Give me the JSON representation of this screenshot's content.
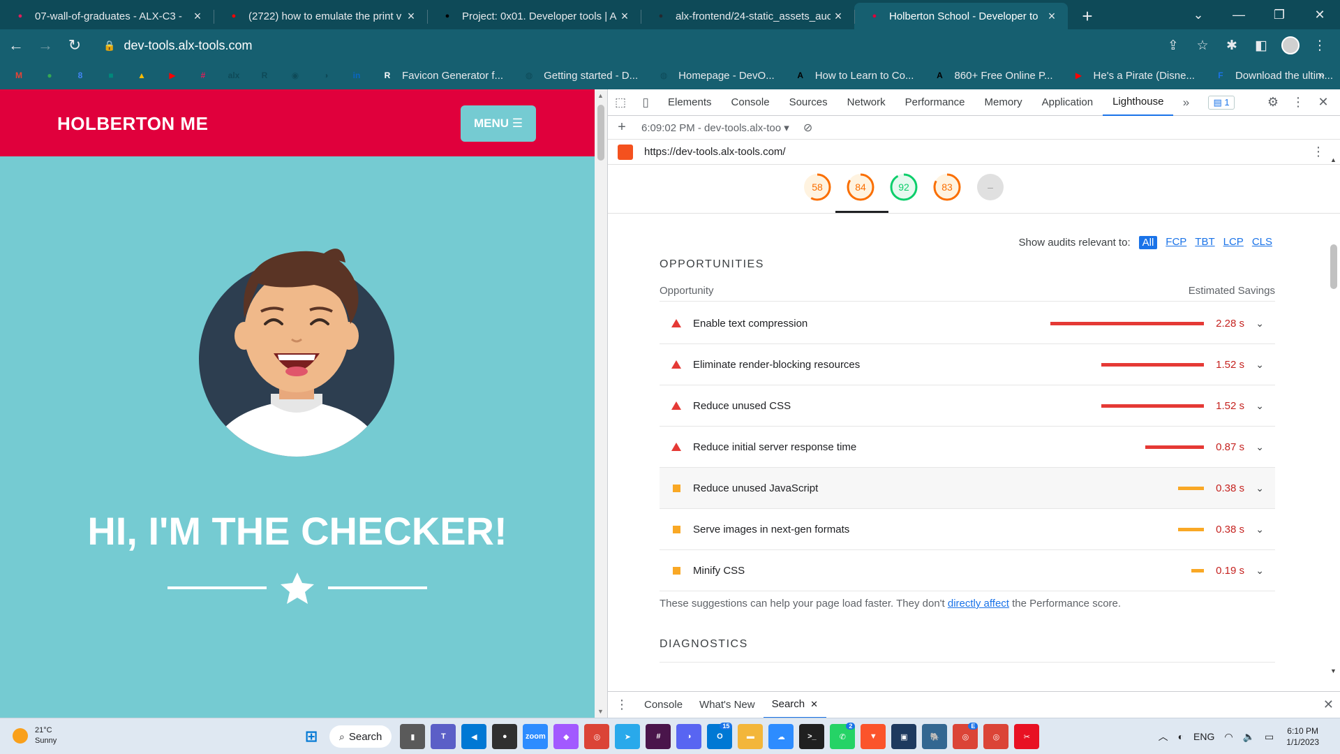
{
  "browser": {
    "tabs": [
      {
        "title": "07-wall-of-graduates - ALX-C3 -",
        "favicon": "slack-icon",
        "color": "#e01e5a",
        "active": false
      },
      {
        "title": "(2722) how to emulate the print v",
        "favicon": "youtube-icon",
        "color": "#ff0000",
        "active": false
      },
      {
        "title": "Project: 0x01. Developer tools | A",
        "favicon": "alx-icon",
        "color": "#000000",
        "active": false
      },
      {
        "title": "alx-frontend/24-static_assets_auc",
        "favicon": "github-icon",
        "color": "#24292f",
        "active": false
      },
      {
        "title": "Holberton School - Developer to",
        "favicon": "holberton-icon",
        "color": "#e0003c",
        "active": true
      }
    ],
    "url": "dev-tools.alx-tools.com",
    "bookmarks": [
      {
        "label": "",
        "icon": "gmail-icon",
        "color": "#ea4335",
        "glyph": "M"
      },
      {
        "label": "",
        "icon": "maps-icon",
        "color": "#34a853",
        "glyph": "●"
      },
      {
        "label": "",
        "icon": "calendar-icon",
        "color": "#4285f4",
        "glyph": "8"
      },
      {
        "label": "",
        "icon": "meet-icon",
        "color": "#00897b",
        "glyph": "■"
      },
      {
        "label": "",
        "icon": "drive-icon",
        "color": "#fbbc04",
        "glyph": "▲"
      },
      {
        "label": "",
        "icon": "youtube-icon",
        "color": "#ff0000",
        "glyph": "▶"
      },
      {
        "label": "",
        "icon": "slack-icon",
        "color": "#e01e5a",
        "glyph": "#"
      },
      {
        "label": "",
        "icon": "alx-icon",
        "color": "#0e4a58",
        "glyph": "alx"
      },
      {
        "label": "",
        "icon": "r-icon",
        "color": "#0e4a58",
        "glyph": "R"
      },
      {
        "label": "",
        "icon": "github-icon",
        "color": "#0e4a58",
        "glyph": "◉"
      },
      {
        "label": "",
        "icon": "discord-icon",
        "color": "#0e4a58",
        "glyph": "◑"
      },
      {
        "label": "",
        "icon": "linkedin-icon",
        "color": "#0a66c2",
        "glyph": "in"
      },
      {
        "label": "Favicon Generator f...",
        "icon": "favicon-generator-icon",
        "color": "#ffffff",
        "glyph": "R"
      },
      {
        "label": "Getting started - D...",
        "icon": "globe-icon",
        "color": "#0e4a58",
        "glyph": "◍"
      },
      {
        "label": "Homepage - DevO...",
        "icon": "globe-icon",
        "color": "#0e4a58",
        "glyph": "◍"
      },
      {
        "label": "How to Learn to Co...",
        "icon": "a-icon",
        "color": "#000000",
        "glyph": "A"
      },
      {
        "label": "860+ Free Online P...",
        "icon": "a-icon",
        "color": "#000000",
        "glyph": "A"
      },
      {
        "label": "He's a Pirate (Disne...",
        "icon": "youtube-icon",
        "color": "#ff0000",
        "glyph": "▶"
      },
      {
        "label": "Download the ultim...",
        "icon": "download-icon",
        "color": "#1a73e8",
        "glyph": "F"
      }
    ],
    "bookmarks_more": "»"
  },
  "site": {
    "logo": "HOLBERTON ME",
    "menu_label": "MENU ☰",
    "hero": "HI, I'M THE CHECKER!",
    "colors": {
      "header": "#e0003c",
      "body": "#75cbd2"
    }
  },
  "devtools": {
    "tabs": [
      "Elements",
      "Console",
      "Sources",
      "Network",
      "Performance",
      "Memory",
      "Application",
      "Lighthouse"
    ],
    "active_tab": "Lighthouse",
    "issues_count": "1",
    "report_label": "6:09:02 PM - dev-tools.alx-too",
    "report_url": "https://dev-tools.alx-tools.com/",
    "scores": [
      {
        "value": "58",
        "color": "#fa6e00",
        "bg": "#fff3e0"
      },
      {
        "value": "84",
        "color": "#fa6e00",
        "bg": "#fff3e0"
      },
      {
        "value": "92",
        "color": "#0cce6b",
        "bg": "#e6f9ef"
      },
      {
        "value": "83",
        "color": "#fa6e00",
        "bg": "#fff3e0"
      },
      {
        "value": "–",
        "color": "#9e9e9e",
        "bg": "#e0e0e0"
      }
    ],
    "filter_label": "Show audits relevant to:",
    "filters": [
      "All",
      "FCP",
      "TBT",
      "LCP",
      "CLS"
    ],
    "opportunities_title": "OPPORTUNITIES",
    "col_opportunity": "Opportunity",
    "col_savings": "Estimated Savings",
    "opportunities": [
      {
        "title": "Enable text compression",
        "savings": "2.28 s",
        "severity": "fail",
        "fraction": 1.0
      },
      {
        "title": "Eliminate render-blocking resources",
        "savings": "1.52 s",
        "severity": "fail",
        "fraction": 0.667
      },
      {
        "title": "Reduce unused CSS",
        "savings": "1.52 s",
        "severity": "fail",
        "fraction": 0.667
      },
      {
        "title": "Reduce initial server response time",
        "savings": "0.87 s",
        "severity": "fail",
        "fraction": 0.382
      },
      {
        "title": "Reduce unused JavaScript",
        "savings": "0.38 s",
        "severity": "average",
        "fraction": 0.167
      },
      {
        "title": "Serve images in next-gen formats",
        "savings": "0.38 s",
        "severity": "average",
        "fraction": 0.167
      },
      {
        "title": "Minify CSS",
        "savings": "0.19 s",
        "severity": "average",
        "fraction": 0.083
      }
    ],
    "note_before": "These suggestions can help your page load faster. They don't ",
    "note_link": "directly affect",
    "note_after": " the Performance score.",
    "diagnostics_title": "DIAGNOSTICS",
    "drawer_tabs": [
      "Console",
      "What's New",
      "Search"
    ],
    "drawer_active": "Search"
  },
  "taskbar": {
    "temp": "21°C",
    "weather": "Sunny",
    "search": "Search",
    "lang": "ENG",
    "time": "6:10 PM",
    "date": "1/1/2023",
    "apps": [
      {
        "icon": "file-explorer-icon",
        "color": "#5a5a5a",
        "glyph": "▮",
        "badge": ""
      },
      {
        "icon": "teams-icon",
        "color": "#5b5fc7",
        "glyph": "T",
        "badge": ""
      },
      {
        "icon": "vscode-icon",
        "color": "#0078d4",
        "glyph": "◀",
        "badge": ""
      },
      {
        "icon": "obs-icon",
        "color": "#303030",
        "glyph": "●",
        "badge": ""
      },
      {
        "icon": "zoom-icon",
        "color": "#2d8cff",
        "glyph": "zoom",
        "badge": ""
      },
      {
        "icon": "figma-icon",
        "color": "#a259ff",
        "glyph": "◆",
        "badge": ""
      },
      {
        "icon": "chrome-icon",
        "color": "#db4437",
        "glyph": "◎",
        "badge": ""
      },
      {
        "icon": "telegram-icon",
        "color": "#29a9eb",
        "glyph": "➤",
        "badge": ""
      },
      {
        "icon": "slack-icon",
        "color": "#4a154b",
        "glyph": "#",
        "badge": ""
      },
      {
        "icon": "discord-icon",
        "color": "#5865f2",
        "glyph": "◑",
        "badge": ""
      },
      {
        "icon": "outlook-icon",
        "color": "#0078d4",
        "glyph": "O",
        "badge": "15"
      },
      {
        "icon": "folder-icon",
        "color": "#f3b63a",
        "glyph": "▬",
        "badge": ""
      },
      {
        "icon": "cloud-icon",
        "color": "#2d8cff",
        "glyph": "☁",
        "badge": ""
      },
      {
        "icon": "terminal-icon",
        "color": "#202020",
        "glyph": ">_",
        "badge": ""
      },
      {
        "icon": "whatsapp-icon",
        "color": "#25d366",
        "glyph": "✆",
        "badge": "2"
      },
      {
        "icon": "brave-icon",
        "color": "#fb542b",
        "glyph": "▼",
        "badge": ""
      },
      {
        "icon": "windows-terminal-icon",
        "color": "#1e3a5f",
        "glyph": "▣",
        "badge": ""
      },
      {
        "icon": "postgres-icon",
        "color": "#336791",
        "glyph": "🐘",
        "badge": ""
      },
      {
        "icon": "chrome-profile-icon",
        "color": "#db4437",
        "glyph": "◎",
        "badge": "E"
      },
      {
        "icon": "chrome-active-icon",
        "color": "#db4437",
        "glyph": "◎",
        "badge": ""
      },
      {
        "icon": "snipping-tool-icon",
        "color": "#e81123",
        "glyph": "✂",
        "badge": ""
      }
    ]
  }
}
